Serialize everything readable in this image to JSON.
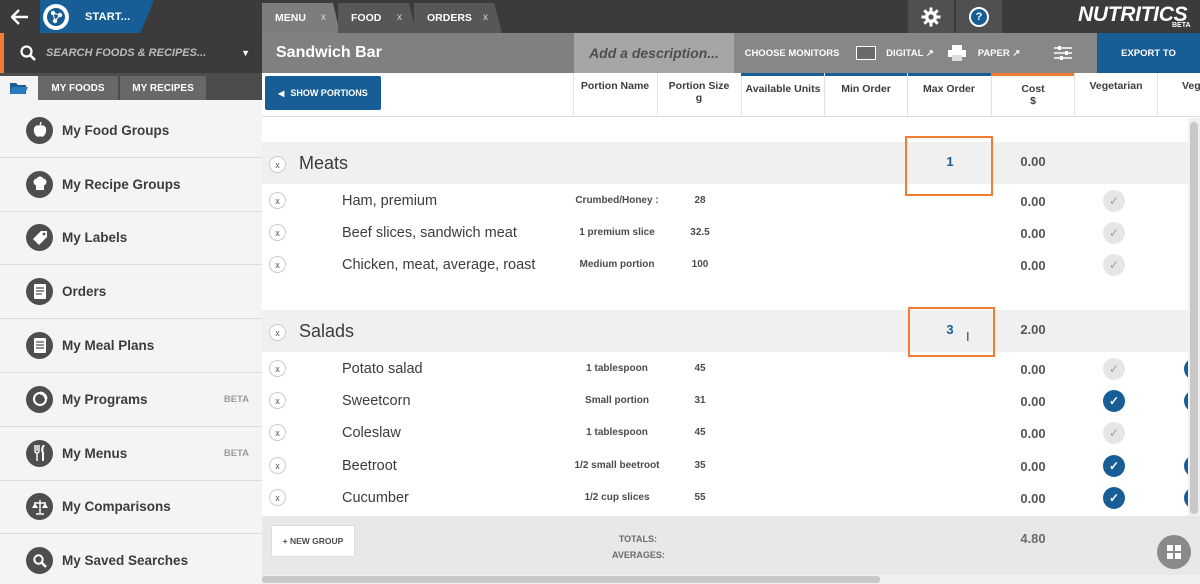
{
  "topbar": {
    "start_label": "START...",
    "tabs": [
      {
        "label": "MENU",
        "close": "x",
        "active": true
      },
      {
        "label": "FOOD",
        "close": "x",
        "active": false
      },
      {
        "label": "ORDERS",
        "close": "x",
        "active": false
      }
    ],
    "help_label": "?",
    "brand": "NUTRITICS",
    "brand_badge": "BETA"
  },
  "sidebar": {
    "search_placeholder": "SEARCH FOODS & RECIPES...",
    "tabs": {
      "foods": "MY FOODS",
      "recipes": "MY RECIPES"
    },
    "items": [
      {
        "label": "My Food Groups",
        "icon": "apple-icon",
        "badge": ""
      },
      {
        "label": "My Recipe Groups",
        "icon": "chef-hat-icon",
        "badge": ""
      },
      {
        "label": "My Labels",
        "icon": "label-tag-icon",
        "badge": ""
      },
      {
        "label": "Orders",
        "icon": "document-icon",
        "badge": ""
      },
      {
        "label": "My Meal Plans",
        "icon": "meal-plan-icon",
        "badge": ""
      },
      {
        "label": "My Programs",
        "icon": "program-icon",
        "badge": "BETA"
      },
      {
        "label": "My Menus",
        "icon": "cutlery-icon",
        "badge": "BETA"
      },
      {
        "label": "My Comparisons",
        "icon": "scales-icon",
        "badge": ""
      },
      {
        "label": "My Saved Searches",
        "icon": "search-icon",
        "badge": ""
      }
    ]
  },
  "main": {
    "title": "Sandwich Bar",
    "description_placeholder": "Add a description...",
    "buttons": {
      "choose_monitors": "CHOOSE MONITORS",
      "digital": "DIGITAL ↗",
      "paper": "PAPER ↗",
      "export": "EXPORT TO"
    },
    "show_portions": "SHOW PORTIONS",
    "columns": {
      "portion_name": "Portion Name",
      "portion_size": "Portion Size",
      "portion_size_unit": "g",
      "available_units": "Available Units",
      "min_order": "Min Order",
      "max_order": "Max Order",
      "cost": "Cost",
      "cost_unit": "$",
      "vegetarian": "Vegetarian",
      "vegan_partial": "Veg"
    },
    "groups": [
      {
        "name": "Meats",
        "max_order": "1",
        "cost": "0.00",
        "items": [
          {
            "name": "Ham, premium",
            "portion_name": "Crumbed/Honey :",
            "portion_size": "28",
            "cost": "0.00",
            "vegetarian": false,
            "vegan": false
          },
          {
            "name": "Beef slices, sandwich meat",
            "portion_name": "1 premium slice",
            "portion_size": "32.5",
            "cost": "0.00",
            "vegetarian": false,
            "vegan": false
          },
          {
            "name": "Chicken, meat, average, roast",
            "portion_name": "Medium portion",
            "portion_size": "100",
            "cost": "0.00",
            "vegetarian": false,
            "vegan": false
          }
        ]
      },
      {
        "name": "Salads",
        "max_order": "3",
        "cost": "2.00",
        "items": [
          {
            "name": "Potato salad",
            "portion_name": "1 tablespoon",
            "portion_size": "45",
            "cost": "0.00",
            "vegetarian": false,
            "vegan": true
          },
          {
            "name": "Sweetcorn",
            "portion_name": "Small portion",
            "portion_size": "31",
            "cost": "0.00",
            "vegetarian": true,
            "vegan": true
          },
          {
            "name": "Coleslaw",
            "portion_name": "1 tablespoon",
            "portion_size": "45",
            "cost": "0.00",
            "vegetarian": false,
            "vegan": false
          },
          {
            "name": "Beetroot",
            "portion_name": "1/2 small beetroot",
            "portion_size": "35",
            "cost": "0.00",
            "vegetarian": true,
            "vegan": true
          },
          {
            "name": "Cucumber",
            "portion_name": "1/2 cup slices",
            "portion_size": "55",
            "cost": "0.00",
            "vegetarian": true,
            "vegan": true
          }
        ]
      }
    ],
    "footer": {
      "new_group": "+ NEW GROUP",
      "totals_label": "TOTALS:",
      "averages_label": "AVERAGES:",
      "total_cost": "4.80"
    }
  },
  "colors": {
    "brand_blue": "#175e96",
    "accent_orange": "#f07d32",
    "dark_bar": "#3b3b3b",
    "title_gray": "#808080"
  }
}
